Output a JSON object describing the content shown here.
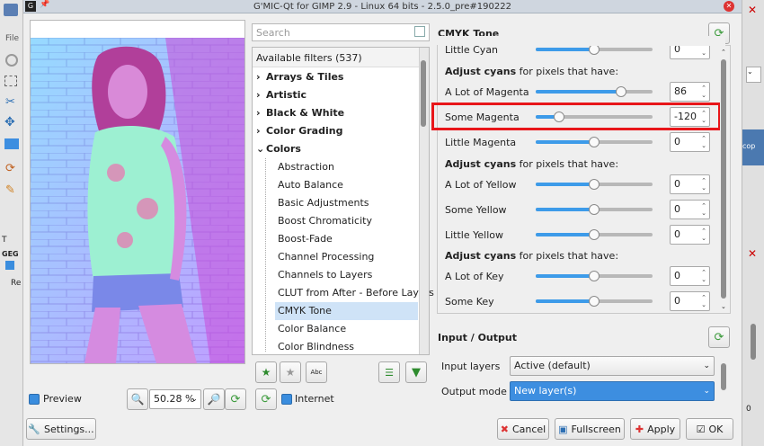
{
  "window": {
    "title": "G'MIC-Qt for GIMP 2.9 - Linux 64 bits - 2.5.0_pre#190222"
  },
  "gimp_bg": {
    "left_menu": "File",
    "left_labels": [
      "T",
      "GEG",
      "Re"
    ],
    "right_labels": [
      "cop",
      "0"
    ]
  },
  "preview": {
    "checkbox_label": "Preview",
    "zoom_value": "50.28 %",
    "settings_label": "Settings..."
  },
  "filters": {
    "search_placeholder": "Search",
    "header": "Available filters (537)",
    "categories": [
      {
        "label": "Arrays & Tiles"
      },
      {
        "label": "Artistic"
      },
      {
        "label": "Black & White"
      },
      {
        "label": "Color Grading"
      },
      {
        "label": "Colors"
      }
    ],
    "color_items": [
      "Abstraction",
      "Auto Balance",
      "Basic Adjustments",
      "Boost Chromaticity",
      "Boost-Fade",
      "Channel Processing",
      "Channels to Layers",
      "CLUT from After - Before Layers",
      "CMYK Tone",
      "Color Balance",
      "Color Blindness"
    ],
    "selected": "CMYK Tone",
    "internet_label": "Internet"
  },
  "params": {
    "title": "CMYK Tone",
    "partial_top": "Little Cyan",
    "partial_top_value": "0",
    "groups": [
      {
        "heading_bold": "Adjust cyans",
        "heading_rest": " for pixels that have:",
        "rows": [
          {
            "label": "A Lot of Magenta",
            "value": "86",
            "pos": 0.73
          },
          {
            "label": "Some Magenta",
            "value": "-120",
            "pos": 0.2,
            "highlight": true
          },
          {
            "label": "Little Magenta",
            "value": "0",
            "pos": 0.5
          }
        ]
      },
      {
        "heading_bold": "Adjust cyans",
        "heading_rest": " for pixels that have:",
        "rows": [
          {
            "label": "A Lot of Yellow",
            "value": "0",
            "pos": 0.5
          },
          {
            "label": "Some Yellow",
            "value": "0",
            "pos": 0.5
          },
          {
            "label": "Little Yellow",
            "value": "0",
            "pos": 0.5
          }
        ]
      },
      {
        "heading_bold": "Adjust cyans",
        "heading_rest": " for pixels that have:",
        "rows": [
          {
            "label": "A Lot of Key",
            "value": "0",
            "pos": 0.5
          },
          {
            "label": "Some Key",
            "value": "0",
            "pos": 0.5
          }
        ]
      }
    ]
  },
  "io": {
    "title": "Input / Output",
    "input_label": "Input layers",
    "input_value": "Active (default)",
    "output_label": "Output mode",
    "output_value": "New layer(s)"
  },
  "buttons": {
    "cancel": "Cancel",
    "fullscreen": "Fullscreen",
    "apply": "Apply",
    "ok": "OK"
  },
  "colors": {
    "accent": "#3d9be9",
    "highlight": "#e8161a",
    "selection": "#cfe3f7"
  }
}
